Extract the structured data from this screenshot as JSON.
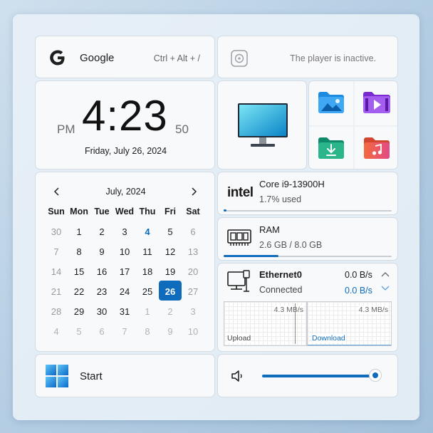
{
  "search": {
    "label": "Google",
    "shortcut": "Ctrl + Alt + /"
  },
  "player": {
    "status": "The player is inactive."
  },
  "clock": {
    "ampm": "PM",
    "time": "4:23",
    "seconds": "50",
    "date": "Friday, July 26, 2024"
  },
  "calendar": {
    "month": "July, 2024",
    "weekdays": [
      "Sun",
      "Mon",
      "Tue",
      "Wed",
      "Thu",
      "Fri",
      "Sat"
    ],
    "weeks": [
      [
        "30",
        "1",
        "2",
        "3",
        "4",
        "5",
        "6"
      ],
      [
        "7",
        "8",
        "9",
        "10",
        "11",
        "12",
        "13"
      ],
      [
        "14",
        "15",
        "16",
        "17",
        "18",
        "19",
        "20"
      ],
      [
        "21",
        "22",
        "23",
        "24",
        "25",
        "26",
        "27"
      ],
      [
        "28",
        "29",
        "30",
        "31",
        "1",
        "2",
        "3"
      ],
      [
        "4",
        "5",
        "6",
        "7",
        "8",
        "9",
        "10"
      ]
    ]
  },
  "cpu": {
    "brand": "intel",
    "name": "Core i9-13900H",
    "usage": "1.7% used",
    "usage_fraction": 0.017
  },
  "ram": {
    "label": "RAM",
    "usage": "2.6 GB / 8.0 GB",
    "usage_fraction": 0.325
  },
  "network": {
    "name": "Ethernet0",
    "status": "Connected",
    "upload_speed": "0.0 B/s",
    "download_speed": "0.0 B/s",
    "upload_scale": "4.3 MB/s",
    "download_scale": "4.3 MB/s",
    "upload_label": "Upload",
    "download_label": "Download"
  },
  "start": {
    "label": "Start"
  },
  "volume": {
    "level_fraction": 1.0
  },
  "colors": {
    "accent": "#0f6cbd",
    "today_bg": "#0f6cbd"
  },
  "icons": {
    "search": "google-g-icon",
    "player": "media-player-icon",
    "desktop": "monitor-icon",
    "pictures": "pictures-folder-icon",
    "videos": "videos-folder-icon",
    "downloads": "downloads-folder-icon",
    "music": "music-folder-icon",
    "ram": "memory-chip-icon",
    "network": "network-icon",
    "start": "windows-logo-icon",
    "volume": "speaker-icon"
  }
}
